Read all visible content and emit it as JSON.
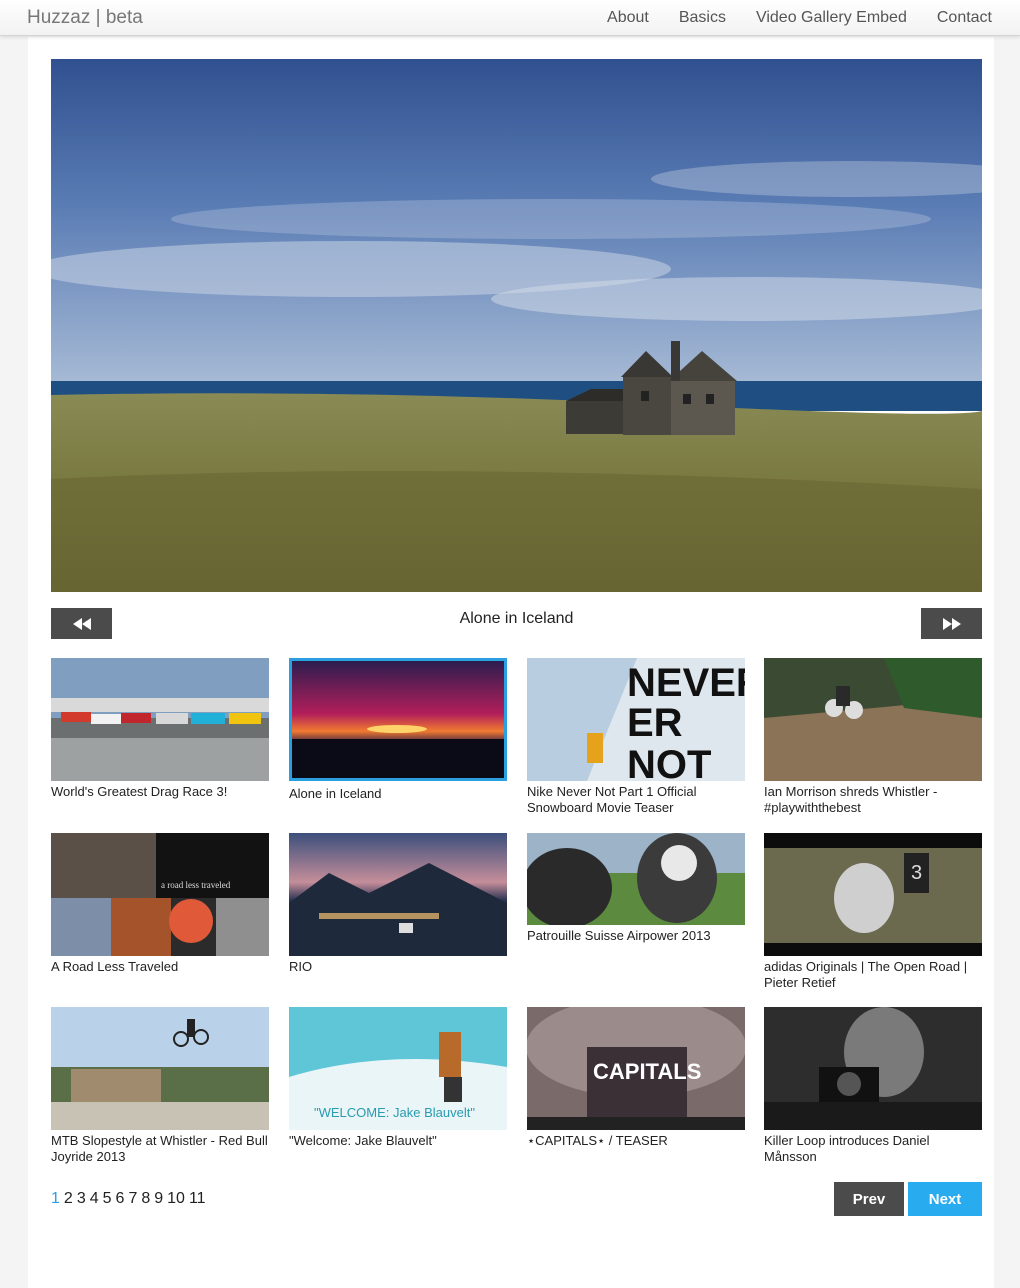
{
  "navbar": {
    "brand": "Huzzaz | beta",
    "links": [
      "About",
      "Basics",
      "Video Gallery Embed",
      "Contact"
    ]
  },
  "player": {
    "now_playing": "Alone in Iceland"
  },
  "videos": [
    {
      "title": "World's Greatest Drag Race 3!"
    },
    {
      "title": "Alone in Iceland"
    },
    {
      "title": "Nike Never Not Part 1 Official Snowboard Movie Teaser"
    },
    {
      "title": "Ian Morrison shreds Whistler - #playwiththebest"
    },
    {
      "title": "A Road Less Traveled"
    },
    {
      "title": "RIO"
    },
    {
      "title": "Patrouille Suisse Airpower 2013"
    },
    {
      "title": "adidas Originals | The Open Road | Pieter Retief"
    },
    {
      "title": "MTB Slopestyle at Whistler - Red Bull Joyride 2013"
    },
    {
      "title": "\"Welcome: Jake Blauvelt\""
    },
    {
      "title": "⋆CAPITALS⋆ / TEASER"
    },
    {
      "title": "Killer Loop introduces Daniel Månsson"
    }
  ],
  "thumb_text": {
    "never_not": [
      "NEVER",
      "ER",
      "NOT"
    ],
    "road": "a road less traveled",
    "welcome": "\"WELCOME: Jake Blauvelt\"",
    "capitals": "CAPITALS",
    "number": "3"
  },
  "pagination": {
    "pages": [
      "1",
      "2",
      "3",
      "4",
      "5",
      "6",
      "7",
      "8",
      "9",
      "10",
      "11"
    ],
    "current": "1",
    "prev_label": "Prev",
    "next_label": "Next"
  }
}
